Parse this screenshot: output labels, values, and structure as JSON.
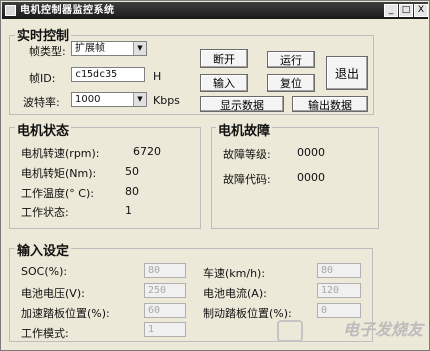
{
  "window": {
    "title": "电机控制器监控系统",
    "minimize_label": "_",
    "maximize_label": "□",
    "close_label": "X"
  },
  "realtime": {
    "title": "实时控制",
    "frame_type_label": "帧类型:",
    "frame_type_value": "扩展帧",
    "frame_id_label": "帧ID:",
    "frame_id_value": "c15dc35",
    "frame_id_unit": "H",
    "baud_label": "波特率:",
    "baud_value": "1000",
    "baud_unit": "Kbps",
    "disconnect_label": "断开",
    "run_label": "运行",
    "input_label": "输入",
    "reset_label": "复位",
    "exit_label": "退出",
    "show_data_label": "显示数据",
    "output_data_label": "输出数据"
  },
  "motor_status": {
    "title": "电机状态",
    "speed_label": "电机转速(rpm):",
    "speed_value": "6720",
    "torque_label": "电机转矩(Nm):",
    "torque_value": "50",
    "temp_label": "工作温度(° C):",
    "temp_value": "80",
    "state_label": "工作状态:",
    "state_value": "1"
  },
  "motor_fault": {
    "title": "电机故障",
    "level_label": "故障等级:",
    "level_value": "0000",
    "code_label": "故障代码:",
    "code_value": "0000"
  },
  "input_settings": {
    "title": "输入设定",
    "soc_label": "SOC(%):",
    "soc_value": "80",
    "vehicle_speed_label": "车速(km/h):",
    "vehicle_speed_value": "80",
    "battery_voltage_label": "电池电压(V):",
    "battery_voltage_value": "250",
    "battery_current_label": "电池电流(A):",
    "battery_current_value": "120",
    "accel_label": "加速踏板位置(%):",
    "accel_value": "60",
    "brake_label": "制动踏板位置(%):",
    "brake_value": "0",
    "mode_label": "工作模式:",
    "mode_value": "1"
  },
  "watermark": {
    "text": "电子发烧友"
  }
}
